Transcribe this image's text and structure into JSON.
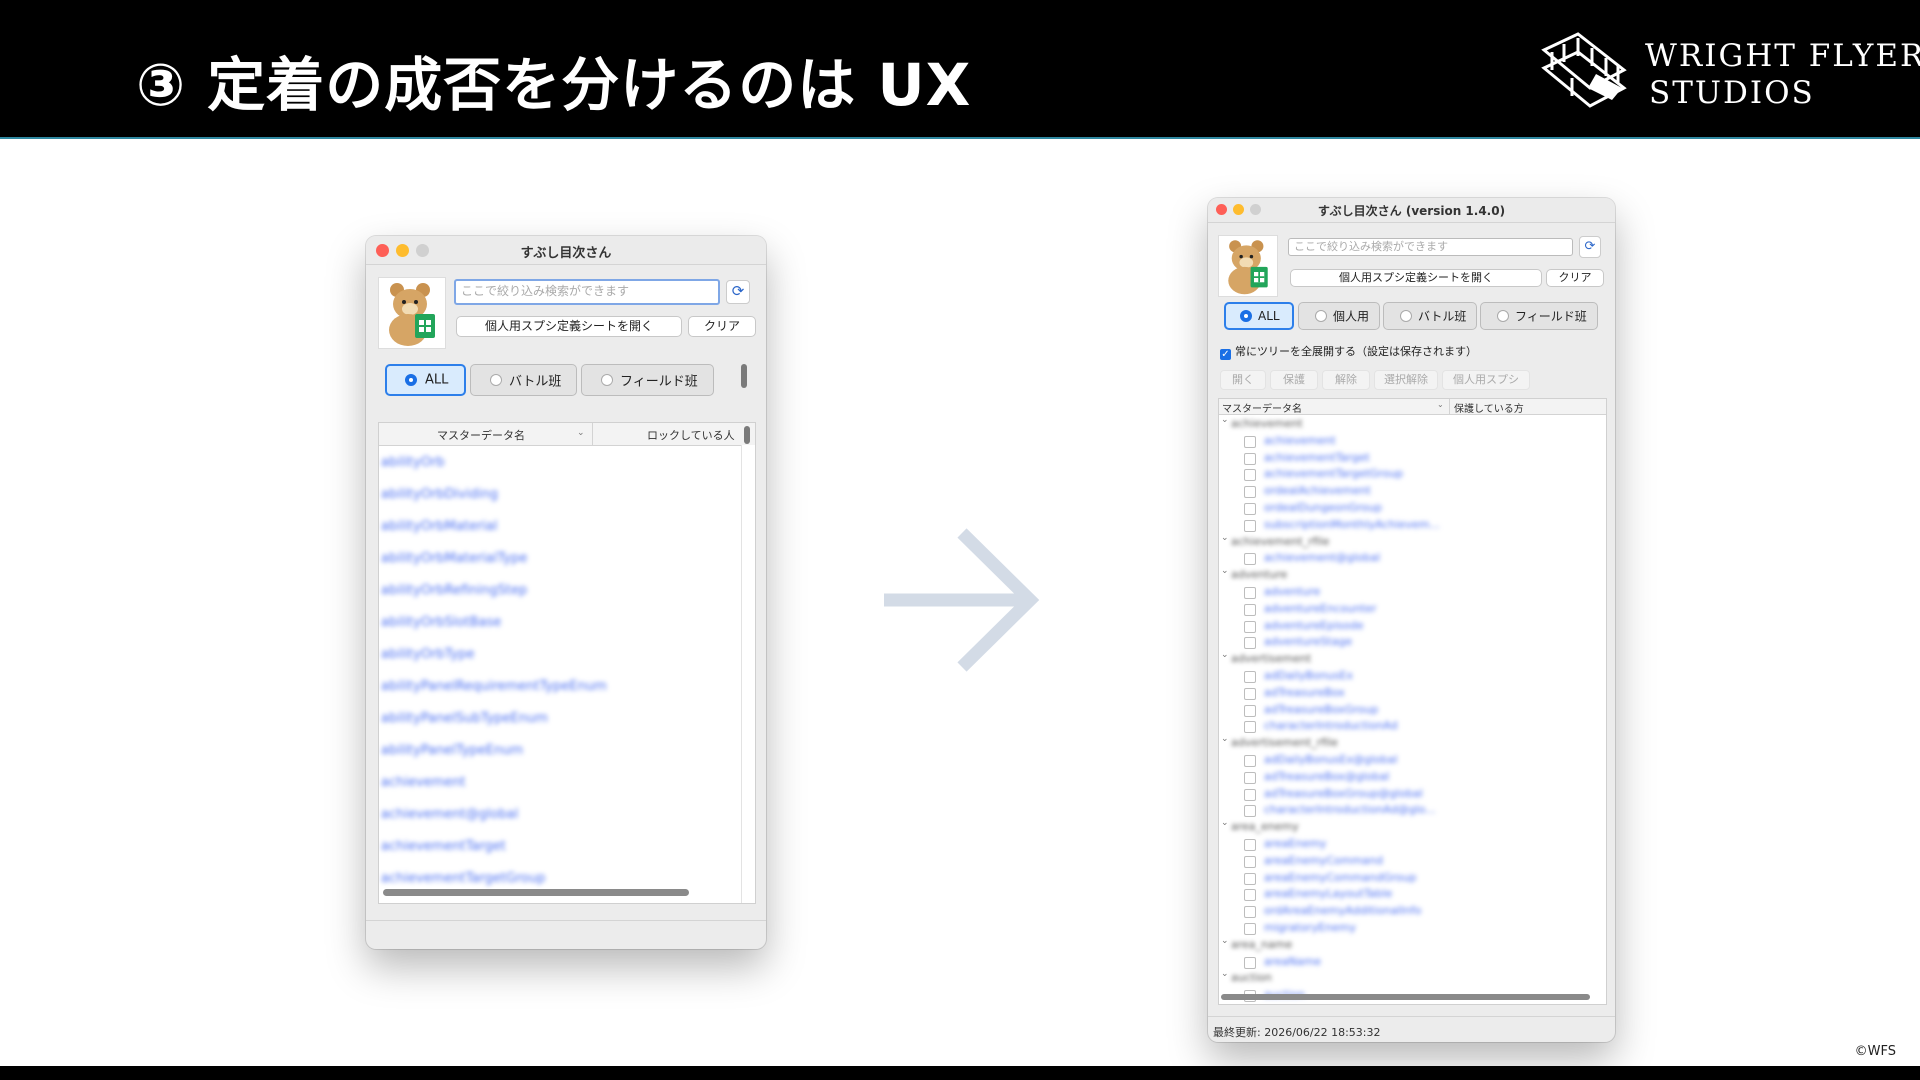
{
  "slide": {
    "title": "③ 定着の成否を分けるのは UX",
    "brand_line1": "WRIGHT FLYER",
    "brand_line2": "STUDIOS",
    "copyright": "©WFS"
  },
  "colors": {
    "accent": "#2d7fea",
    "link": "#4a6ff2",
    "arrow": "#d3dbe6",
    "header_bg": "#000000"
  },
  "left_window": {
    "title": "すぶし目次さん",
    "search_placeholder": "ここで絞り込み検索ができます",
    "open_sheet_label": "個人用スプシ定義シートを開く",
    "clear_label": "クリア",
    "filters": [
      {
        "label": "ALL",
        "selected": true
      },
      {
        "label": "バトル班",
        "selected": false
      },
      {
        "label": "フィールド班",
        "selected": false
      }
    ],
    "columns": [
      "マスターデータ名",
      "ロックしている人"
    ],
    "rows": [
      "abilityOrb",
      "abilityOrbDividing",
      "abilityOrbMaterial",
      "abilityOrbMaterialType",
      "abilityOrbRefiningStep",
      "abilityOrbSlotBase",
      "abilityOrbType",
      "abilityPanelRequirementTypeEnum",
      "abilityPanelSubTypeEnum",
      "abilityPanelTypeEnum",
      "achievement",
      "achievement@global",
      "achievementTarget",
      "achievementTargetGroup"
    ]
  },
  "right_window": {
    "title": "すぶし目次さん (version 1.4.0)",
    "search_placeholder": "ここで絞り込み検索ができます",
    "open_sheet_label": "個人用スプシ定義シートを開く",
    "clear_label": "クリア",
    "filters": [
      {
        "label": "ALL",
        "selected": true
      },
      {
        "label": "個人用",
        "selected": false
      },
      {
        "label": "バトル班",
        "selected": false
      },
      {
        "label": "フィールド班",
        "selected": false
      }
    ],
    "expand_all_label": "常にツリーを全展開する（設定は保存されます）",
    "expand_all_checked": true,
    "action_buttons": [
      "開く",
      "保護",
      "解除",
      "選択解除",
      "個人用スプシ"
    ],
    "columns": [
      "マスターデータ名",
      "保護している方"
    ],
    "tree": [
      {
        "group": "achievement",
        "items": [
          "achievement",
          "achievementTarget",
          "achievementTargetGroup",
          "ordealAchievement",
          "ordealDungeonGroup",
          "subscriptionMonthlyAchievem..."
        ]
      },
      {
        "group": "achievement_rfile",
        "items": [
          "achievement@global"
        ]
      },
      {
        "group": "adventure",
        "items": [
          "adventure",
          "adventureEncounter",
          "adventureEpisode",
          "adventureStage"
        ]
      },
      {
        "group": "advertisement",
        "items": [
          "adDailyBonusEx",
          "adTreasureBox",
          "adTreasureBoxGroup",
          "characterIntroductionAd"
        ]
      },
      {
        "group": "advertisement_rfile",
        "items": [
          "adDailyBonusEx@global",
          "adTreasureBox@global",
          "adTreasureBoxGroup@global",
          "characterIntroductionAd@glo..."
        ]
      },
      {
        "group": "area_enemy",
        "items": [
          "areaEnemy",
          "areaEnemyCommand",
          "areaEnemyCommandGroup",
          "areaEnemyLayoutTable",
          "ordAreaEnemyAdditionalInfo",
          "migratoryEnemy"
        ]
      },
      {
        "group": "area_name",
        "items": [
          "areaName"
        ]
      },
      {
        "group": "auction",
        "items": [
          "auction"
        ]
      }
    ],
    "status_text": "最終更新: 2026/06/22 18:53:32"
  }
}
